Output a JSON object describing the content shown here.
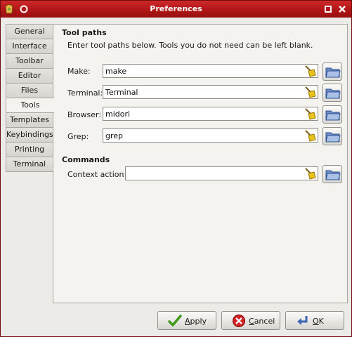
{
  "window": {
    "title": "Preferences"
  },
  "tabs": [
    {
      "label": "General"
    },
    {
      "label": "Interface"
    },
    {
      "label": "Toolbar"
    },
    {
      "label": "Editor"
    },
    {
      "label": "Files"
    },
    {
      "label": "Tools",
      "active": true
    },
    {
      "label": "Templates"
    },
    {
      "label": "Keybindings"
    },
    {
      "label": "Printing"
    },
    {
      "label": "Terminal"
    }
  ],
  "tool_paths": {
    "heading": "Tool paths",
    "description": "Enter tool paths below. Tools you do not need can be left blank.",
    "make": {
      "label": "Make:",
      "value": "make"
    },
    "terminal": {
      "label": "Terminal:",
      "value": "Terminal"
    },
    "browser": {
      "label": "Browser:",
      "value": "midori"
    },
    "grep": {
      "label": "Grep:",
      "value": "grep"
    }
  },
  "commands": {
    "heading": "Commands",
    "context_action": {
      "label": "Context action:",
      "value": ""
    }
  },
  "buttons": {
    "apply": {
      "prefix": "",
      "mnemonic": "A",
      "rest": "pply"
    },
    "cancel": {
      "prefix": "",
      "mnemonic": "C",
      "rest": "ancel"
    },
    "ok": {
      "prefix": "",
      "mnemonic": "O",
      "rest": "K"
    }
  },
  "colors": {
    "titlebar": "#b01617",
    "accent_text": "#ffffff"
  },
  "icons": [
    "geany-app-icon",
    "settings-menu-icon",
    "minimize-icon",
    "close-icon",
    "clear-broom-icon",
    "open-folder-icon",
    "apply-check-icon",
    "cancel-x-icon",
    "ok-return-icon"
  ]
}
